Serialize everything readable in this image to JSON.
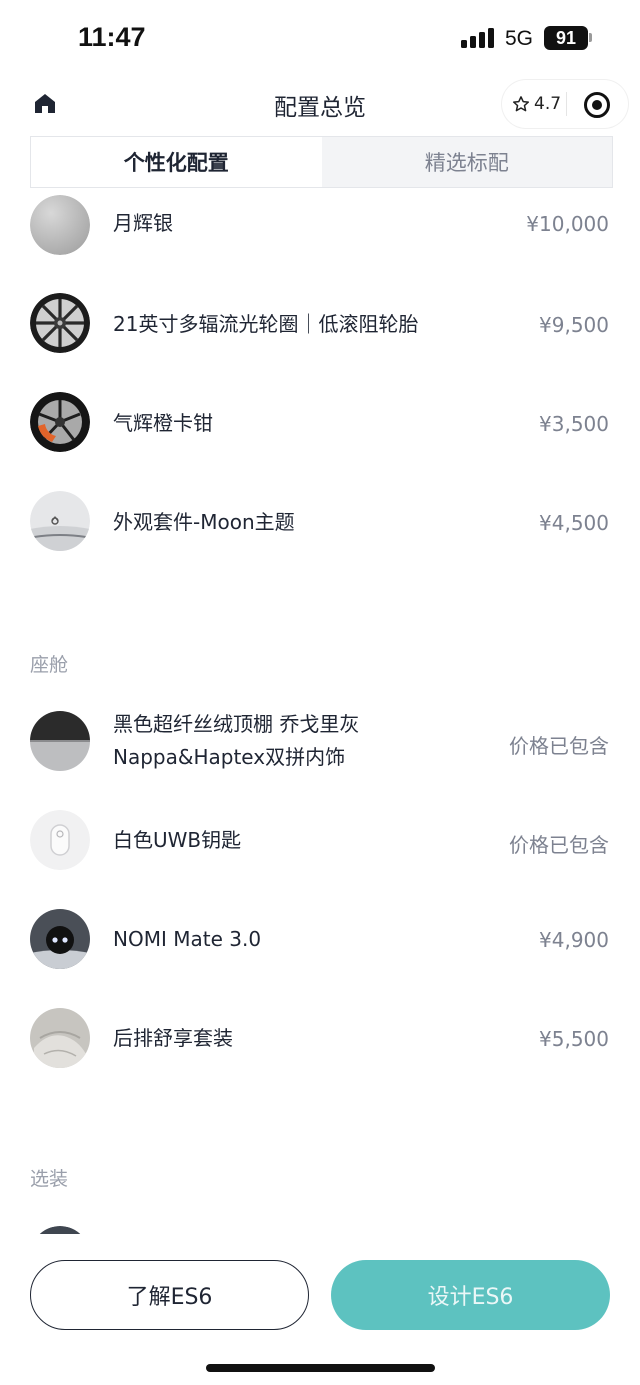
{
  "status_bar": {
    "time": "11:47",
    "network": "5G",
    "battery": "91"
  },
  "nav": {
    "title": "配置总览",
    "rating": "4.7"
  },
  "tabs": [
    {
      "label": "个性化配置",
      "active": true
    },
    {
      "label": "精选标配",
      "active": false
    }
  ],
  "exterior_items": [
    {
      "name": "月辉银",
      "price": "¥10,000",
      "icon": "silver-color-swatch"
    },
    {
      "name": "21英寸多辐流光轮圈｜低滚阻轮胎",
      "price": "¥9,500",
      "icon": "wheel-rim"
    },
    {
      "name": "气辉橙卡钳",
      "price": "¥3,500",
      "icon": "orange-caliper-wheel"
    },
    {
      "name": "外观套件-Moon主题",
      "price": "¥4,500",
      "icon": "car-front"
    }
  ],
  "cabin": {
    "title": "座舱",
    "items": [
      {
        "name_line1": "黑色超纤丝绒顶棚 乔戈里灰",
        "name_line2": "Nappa&Haptex双拼内饰",
        "price": "价格已包含",
        "icon": "interior-swatch"
      },
      {
        "name": "白色UWB钥匙",
        "price": "价格已包含",
        "icon": "uwb-key"
      },
      {
        "name": "NOMI Mate 3.0",
        "price": "¥4,900",
        "icon": "nomi-robot"
      },
      {
        "name": "后排舒享套装",
        "price": "¥5,500",
        "icon": "rear-seat"
      }
    ]
  },
  "options": {
    "title": "选装"
  },
  "buttons": {
    "learn": "了解ES6",
    "design": "设计ES6"
  },
  "colors": {
    "accent": "#5dc2c0",
    "text": "#1f2533",
    "muted": "#7d8290"
  }
}
